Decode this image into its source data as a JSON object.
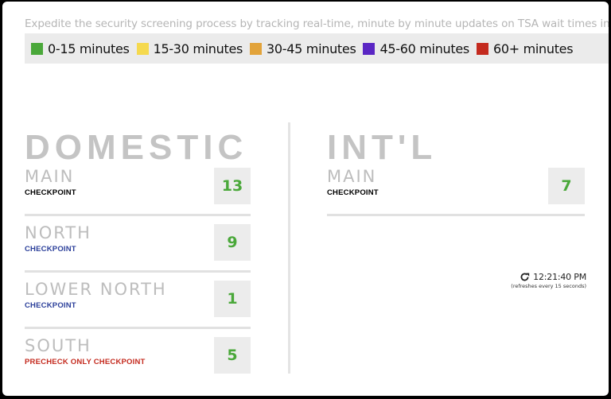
{
  "tagline": "Expedite the security screening process by tracking real-time, minute by minute updates on TSA wait times in ATL",
  "legend": [
    {
      "label": "0-15 minutes",
      "color": "#4aa83a"
    },
    {
      "label": "15-30 minutes",
      "color": "#f5d94e"
    },
    {
      "label": "30-45 minutes",
      "color": "#e2a33a"
    },
    {
      "label": "45-60 minutes",
      "color": "#5a26c4"
    },
    {
      "label": "60+ minutes",
      "color": "#c42a1e"
    }
  ],
  "domestic": {
    "title": "DOMESTIC",
    "checkpoints": [
      {
        "name": "MAIN",
        "type": "CHECKPOINT",
        "type_color": "#000000",
        "wait": "13",
        "wait_color": "#4aa83a"
      },
      {
        "name": "NORTH",
        "type": "CHECKPOINT",
        "type_color": "#2b3f9a",
        "wait": "9",
        "wait_color": "#4aa83a"
      },
      {
        "name": "LOWER NORTH",
        "type": "CHECKPOINT",
        "type_color": "#2b3f9a",
        "wait": "1",
        "wait_color": "#4aa83a"
      },
      {
        "name": "SOUTH",
        "type": "PRECHECK ONLY CHECKPOINT",
        "type_color": "#c42a1e",
        "wait": "5",
        "wait_color": "#4aa83a"
      }
    ]
  },
  "international": {
    "title": "INT'L",
    "checkpoints": [
      {
        "name": "MAIN",
        "type": "CHECKPOINT",
        "type_color": "#000000",
        "wait": "7",
        "wait_color": "#4aa83a"
      }
    ]
  },
  "refresh": {
    "icon": "refresh-icon",
    "time": "12:21:40 PM",
    "note": "(refreshes every 15 seconds)"
  }
}
